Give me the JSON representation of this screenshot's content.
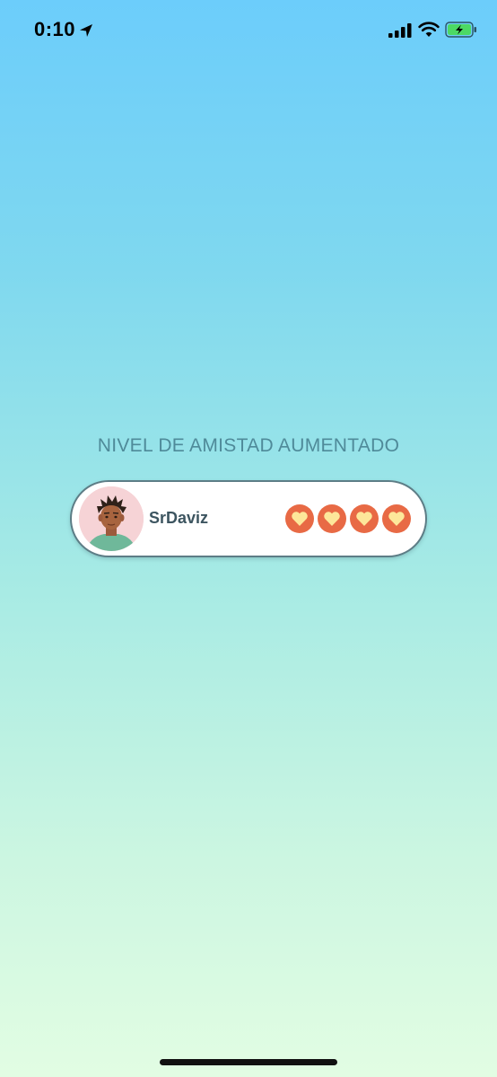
{
  "status_bar": {
    "time": "0:10",
    "icons": [
      "location-arrow-icon",
      "signal-bars-icon",
      "wifi-icon",
      "battery-charging-icon"
    ],
    "battery_color": "#4cd964"
  },
  "screen": {
    "heading": "NIVEL DE AMISTAD AUMENTADO"
  },
  "friend": {
    "name": "SrDaviz",
    "friendship_hearts_filled": 4,
    "friendship_hearts_total": 4,
    "heart_badge_color": "#e86a45",
    "heart_color": "#fde79a"
  },
  "colors": {
    "gradient_top": "#6ccdfb",
    "gradient_bottom": "#e2fde3",
    "heading_text": "#4f8a99",
    "name_text": "#3d5560"
  }
}
